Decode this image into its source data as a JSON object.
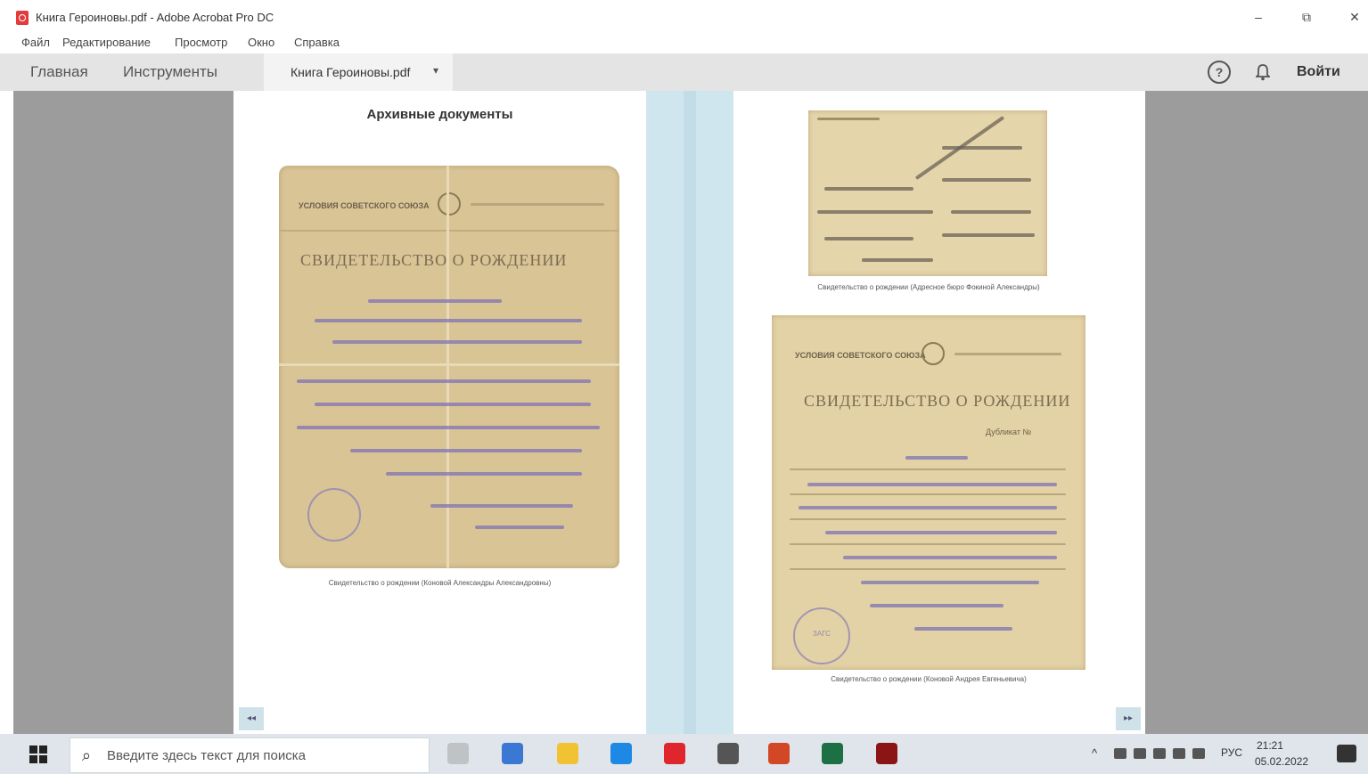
{
  "titlebar": {
    "title": "Книга Героиновы.pdf - Adobe Acrobat Pro DC",
    "minimize": "–",
    "maximize": "⧉",
    "close": "✕"
  },
  "menubar": {
    "items": [
      "Файл",
      "Редактирование",
      "Просмотр",
      "Окно",
      "Справка"
    ]
  },
  "tabs": {
    "home": "Главная",
    "tools": "Инструменты",
    "document": "Книга Героиновы.pdf",
    "chevron": "▾",
    "help": "?",
    "signin": "Войти"
  },
  "page_left": {
    "heading": "Архивные документы",
    "document": {
      "header": "УСЛОВИЯ СОВЕТСКОГО СОЮЗА",
      "title": "СВИДЕТЕЛЬСТВО О РОЖДЕНИИ"
    },
    "caption": "Свидетельство о рождении (Коновой Александры Александровны)"
  },
  "page_right": {
    "top_caption": "Свидетельство о рождении (Адресное бюро Фокиной Александры)",
    "document": {
      "header": "УСЛОВИЯ СОВЕТСКОГО СОЮЗА",
      "title": "СВИДЕТЕЛЬСТВО О РОЖДЕНИИ",
      "number": "Дубликат № ",
      "stamp_text": "ЗАГС"
    },
    "bottom_caption": "Свидетельство о рождении (Коновой Андрея Евгеньевича)"
  },
  "page_nav": {
    "left": "◂◂",
    "right": "▸▸"
  },
  "taskbar": {
    "search_placeholder": "Введите здесь текст для поиска",
    "search_icon": "⌕",
    "tray_arrow": "^",
    "language": "РУС",
    "time": "21:21",
    "date": "05.02.2022",
    "apps": [
      {
        "name": "task-view-icon",
        "color": "#bfc3c6"
      },
      {
        "name": "edge-icon",
        "color": "#3a78d4"
      },
      {
        "name": "file-explorer-icon",
        "color": "#f1c232"
      },
      {
        "name": "store-icon",
        "color": "#1e88e5"
      },
      {
        "name": "opera-icon",
        "color": "#e0262d"
      },
      {
        "name": "calculator-icon",
        "color": "#555555"
      },
      {
        "name": "powerpoint-icon",
        "color": "#d24726"
      },
      {
        "name": "excel-icon",
        "color": "#1d7044"
      },
      {
        "name": "acrobat-icon",
        "color": "#8b1515"
      }
    ]
  }
}
